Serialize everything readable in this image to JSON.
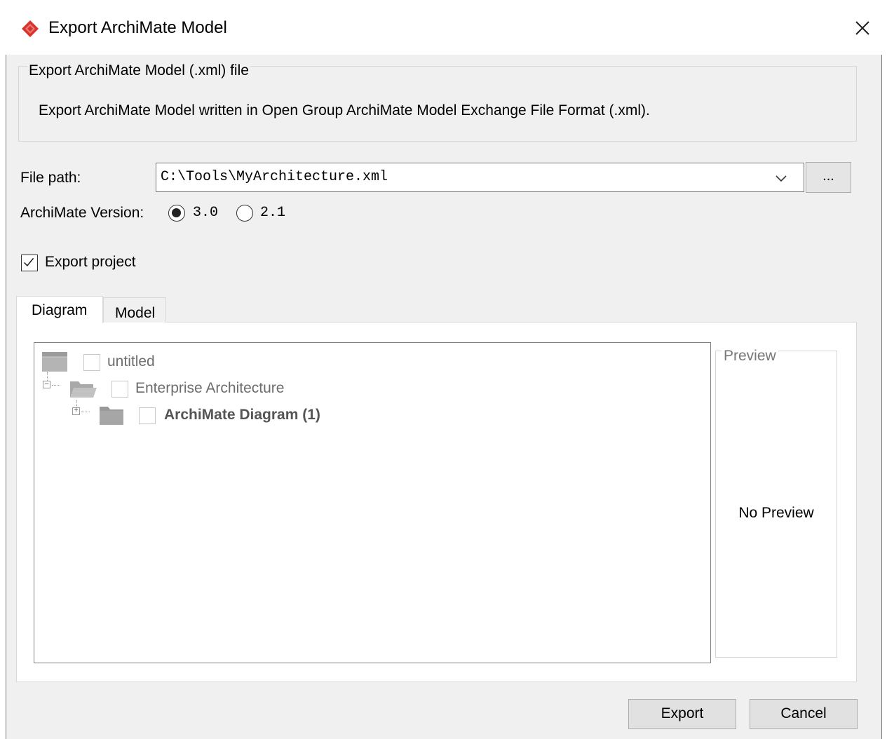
{
  "window": {
    "title": "Export ArchiMate Model"
  },
  "description": {
    "legend": "Export ArchiMate Model (.xml) file",
    "text": "Export ArchiMate Model written in Open Group ArchiMate Model Exchange File Format (.xml)."
  },
  "form": {
    "file_path_label": "File path:",
    "file_path_value": "C:\\Tools\\MyArchitecture.xml",
    "browse_label": "...",
    "version_label": "ArchiMate Version:",
    "version_options": [
      "3.0",
      "2.1"
    ],
    "version_selected": "3.0",
    "export_project_label": "Export project",
    "export_project_checked": true
  },
  "tabs": [
    {
      "label": "Diagram",
      "active": true
    },
    {
      "label": "Model",
      "active": false
    }
  ],
  "tree": [
    {
      "label": "untitled",
      "level": 0,
      "icon": "project-icon",
      "checked": false
    },
    {
      "label": "Enterprise Architecture",
      "level": 1,
      "icon": "folder-open-icon",
      "expanded": true,
      "checked": false
    },
    {
      "label": "ArchiMate Diagram (1)",
      "level": 2,
      "icon": "folder-icon",
      "expanded": false,
      "bold": true,
      "checked": false
    }
  ],
  "preview": {
    "legend": "Preview",
    "empty_text": "No Preview"
  },
  "buttons": {
    "export": "Export",
    "cancel": "Cancel"
  },
  "colors": {
    "app_icon": "#d9342b",
    "dialog_bg": "#f0f0f0",
    "tree_text": "#6d6d6d"
  }
}
